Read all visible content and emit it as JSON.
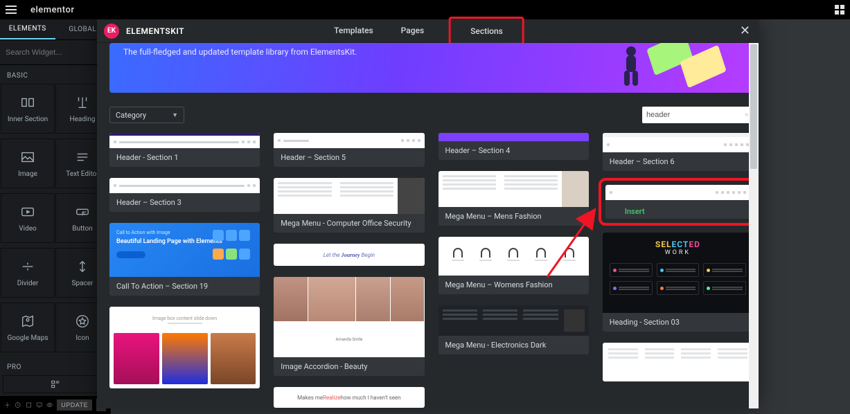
{
  "topbar": {
    "brand": "elementor"
  },
  "sidebar": {
    "tabs": {
      "elements": "ELEMENTS",
      "global": "GLOBAL"
    },
    "search_placeholder": "Search Widget...",
    "basic_label": "BASIC",
    "pro_label": "PRO",
    "widgets": {
      "inner_section": "Inner Section",
      "heading": "Heading",
      "image": "Image",
      "text_editor": "Text Editor",
      "video": "Video",
      "button": "Button",
      "divider": "Divider",
      "spacer": "Spacer",
      "google_maps": "Google Maps",
      "icon": "Icon"
    }
  },
  "bottombar": {
    "update": "UPDATE"
  },
  "modal": {
    "logo_text": "EK",
    "title": "ELEMENTSKIT",
    "tabs": {
      "templates": "Templates",
      "pages": "Pages",
      "sections": "Sections"
    },
    "hero_text": "The full-fledged and updated template library from ElementsKit.",
    "category_label": "Category",
    "search_value": "header",
    "insert_label": "Insert"
  },
  "cards": {
    "c1": "Header - Section 1",
    "c2": "Header – Section 3",
    "c3": "Call To Action – Section 19",
    "c5": "Header – Section 5",
    "c6": "Mega Menu - Computer Office Security",
    "c7": "Image Accordion - Beauty",
    "c8": "Header – Section 4",
    "c9": "Mega Menu – Mens Fashion",
    "c10": "Mega Menu – Womens Fashion",
    "c11": "Mega Menu - Electronics Dark",
    "c12": "Header – Section 6",
    "c14": "Heading - Section 03"
  },
  "thumb": {
    "cta_small": "Call to Action with Image",
    "cta_big": "Beautiful Landing Page with Elements",
    "journey_pre": "Let the ",
    "journey_mid": "Journey",
    "journey_post": " Begin",
    "realize_pre": "Makes me ",
    "realize_mid": "Realize",
    "realize_post": " how much I haven't seen",
    "accordion_top": "Image box content slide down",
    "selected_title": "SELECTED",
    "selected_work": "WORK"
  }
}
